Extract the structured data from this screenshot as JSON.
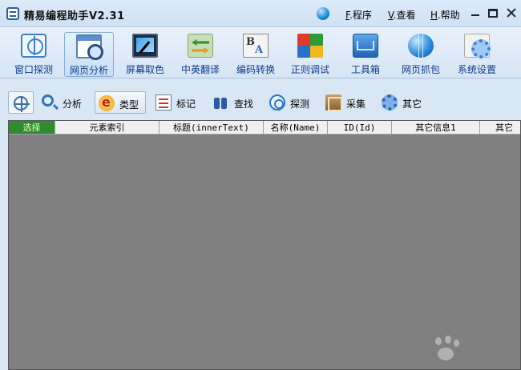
{
  "window": {
    "title": "精易编程助手V2.31",
    "menu": [
      {
        "key": "F",
        "label": "程序"
      },
      {
        "key": "V",
        "label": "查看"
      },
      {
        "key": "H",
        "label": "帮助"
      }
    ]
  },
  "toolbar": {
    "items": [
      {
        "label": "窗口探测",
        "icon": "window-probe-icon"
      },
      {
        "label": "网页分析",
        "icon": "web-analyze-icon",
        "active": true
      },
      {
        "label": "屏幕取色",
        "icon": "screen-color-picker-icon"
      },
      {
        "label": "中英翻译",
        "icon": "translate-icon"
      },
      {
        "label": "编码转换",
        "icon": "encoding-convert-icon"
      },
      {
        "label": "正则调试",
        "icon": "regex-debug-icon"
      },
      {
        "label": "工具箱",
        "icon": "toolbox-icon"
      },
      {
        "label": "网页抓包",
        "icon": "packet-capture-icon"
      },
      {
        "label": "系统设置",
        "icon": "system-settings-icon"
      }
    ]
  },
  "subtoolbar": {
    "items": [
      {
        "label": "分析",
        "icon": "analyze-icon"
      },
      {
        "label": "类型",
        "icon": "type-icon",
        "active": true
      },
      {
        "label": "标记",
        "icon": "mark-icon"
      },
      {
        "label": "查找",
        "icon": "find-icon"
      },
      {
        "label": "探测",
        "icon": "probe-icon"
      },
      {
        "label": "采集",
        "icon": "collect-icon"
      },
      {
        "label": "其它",
        "icon": "other-icon"
      }
    ]
  },
  "grid": {
    "columns": [
      "选择",
      "元素索引",
      "标题(innerText)",
      "名称(Name)",
      "ID(Id)",
      "其它信息1",
      "其它"
    ],
    "rows": []
  }
}
